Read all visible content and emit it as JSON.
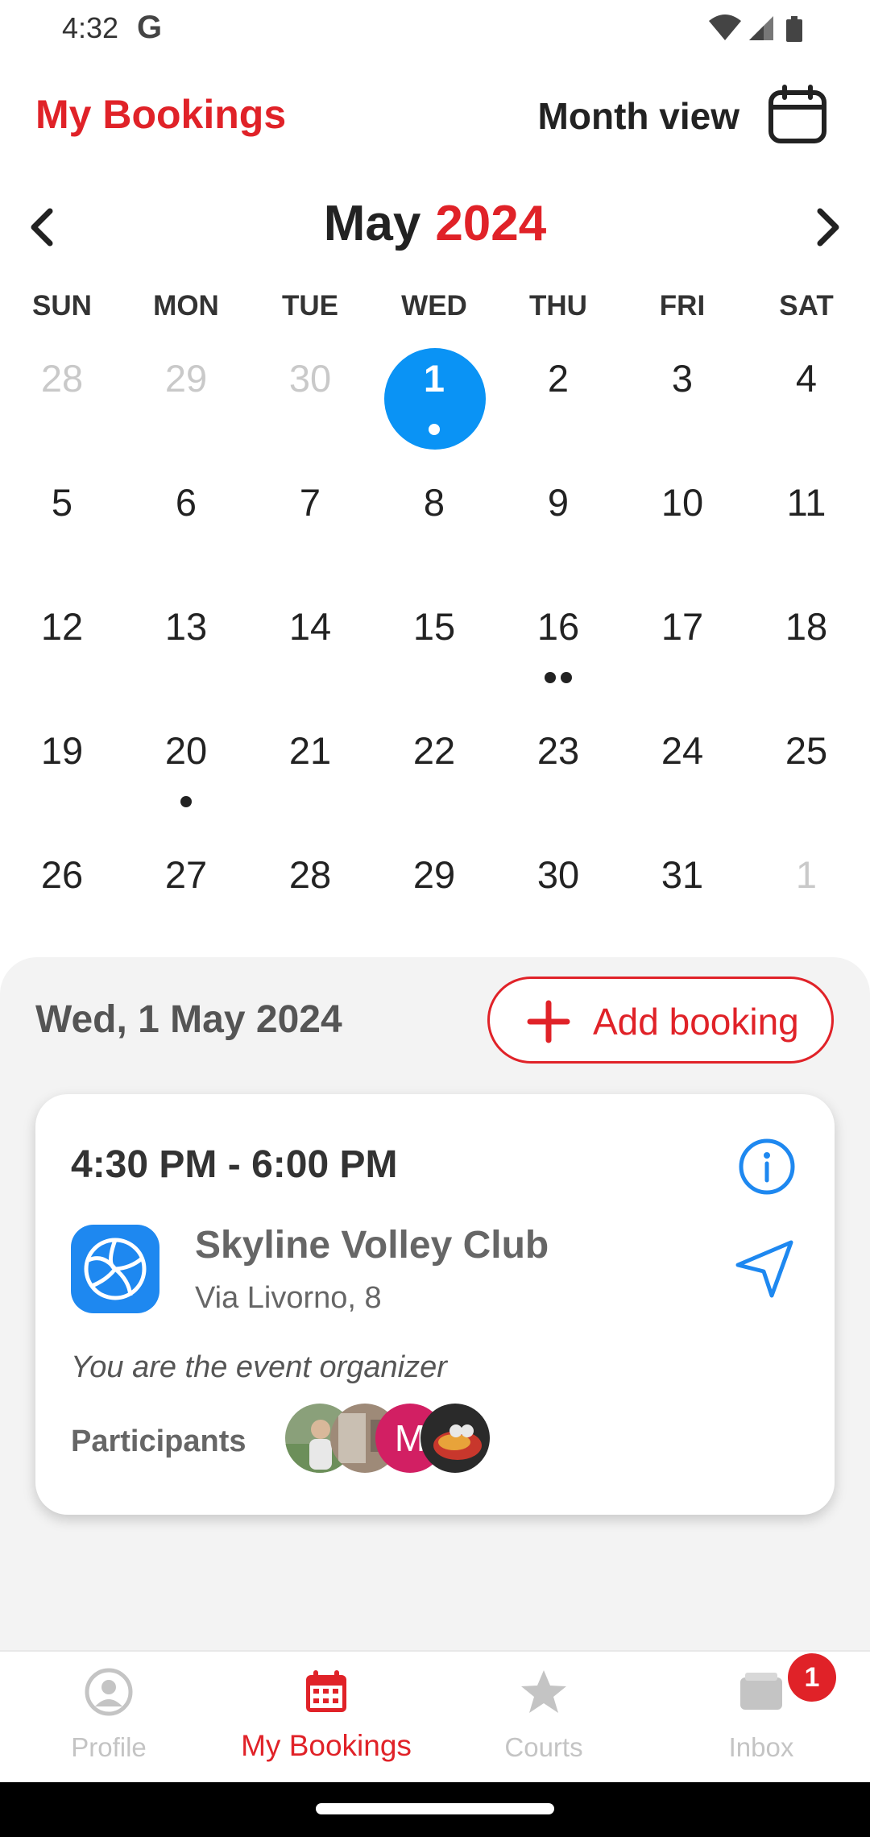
{
  "status_bar": {
    "time": "4:32",
    "google_glyph": "G"
  },
  "header": {
    "title": "My Bookings",
    "view_label": "Month view"
  },
  "calendar": {
    "month": "May",
    "year": "2024",
    "weekdays": [
      "SUN",
      "MON",
      "TUE",
      "WED",
      "THU",
      "FRI",
      "SAT"
    ],
    "weeks": [
      [
        {
          "d": "28",
          "other": true
        },
        {
          "d": "29",
          "other": true
        },
        {
          "d": "30",
          "other": true
        },
        {
          "d": "1",
          "selected": true,
          "dots": 1
        },
        {
          "d": "2"
        },
        {
          "d": "3"
        },
        {
          "d": "4"
        }
      ],
      [
        {
          "d": "5"
        },
        {
          "d": "6"
        },
        {
          "d": "7"
        },
        {
          "d": "8"
        },
        {
          "d": "9"
        },
        {
          "d": "10"
        },
        {
          "d": "11"
        }
      ],
      [
        {
          "d": "12"
        },
        {
          "d": "13"
        },
        {
          "d": "14"
        },
        {
          "d": "15"
        },
        {
          "d": "16",
          "dots": 2
        },
        {
          "d": "17"
        },
        {
          "d": "18"
        }
      ],
      [
        {
          "d": "19"
        },
        {
          "d": "20",
          "dots": 1
        },
        {
          "d": "21"
        },
        {
          "d": "22"
        },
        {
          "d": "23"
        },
        {
          "d": "24"
        },
        {
          "d": "25"
        }
      ],
      [
        {
          "d": "26"
        },
        {
          "d": "27"
        },
        {
          "d": "28"
        },
        {
          "d": "29"
        },
        {
          "d": "30"
        },
        {
          "d": "31"
        },
        {
          "d": "1",
          "other": true
        }
      ]
    ]
  },
  "panel": {
    "selected_date": "Wed, 1 May 2024",
    "add_booking_label": "Add booking"
  },
  "booking": {
    "time_range": "4:30 PM - 6:00 PM",
    "club_name": "Skyline Volley Club",
    "address": "Via Livorno, 8",
    "organizer_note": "You are the event organizer",
    "participants_label": "Participants",
    "avatar_m_initial": "M"
  },
  "bottom_nav": {
    "items": [
      {
        "label": "Profile",
        "icon": "profile-icon"
      },
      {
        "label": "My Bookings",
        "icon": "calendar-icon",
        "active": true
      },
      {
        "label": "Courts",
        "icon": "star-icon"
      },
      {
        "label": "Inbox",
        "icon": "inbox-icon",
        "badge": "1"
      }
    ]
  },
  "colors": {
    "accent": "#e02228",
    "selected_day": "#0a93f5",
    "club_logo": "#1e88f0"
  }
}
